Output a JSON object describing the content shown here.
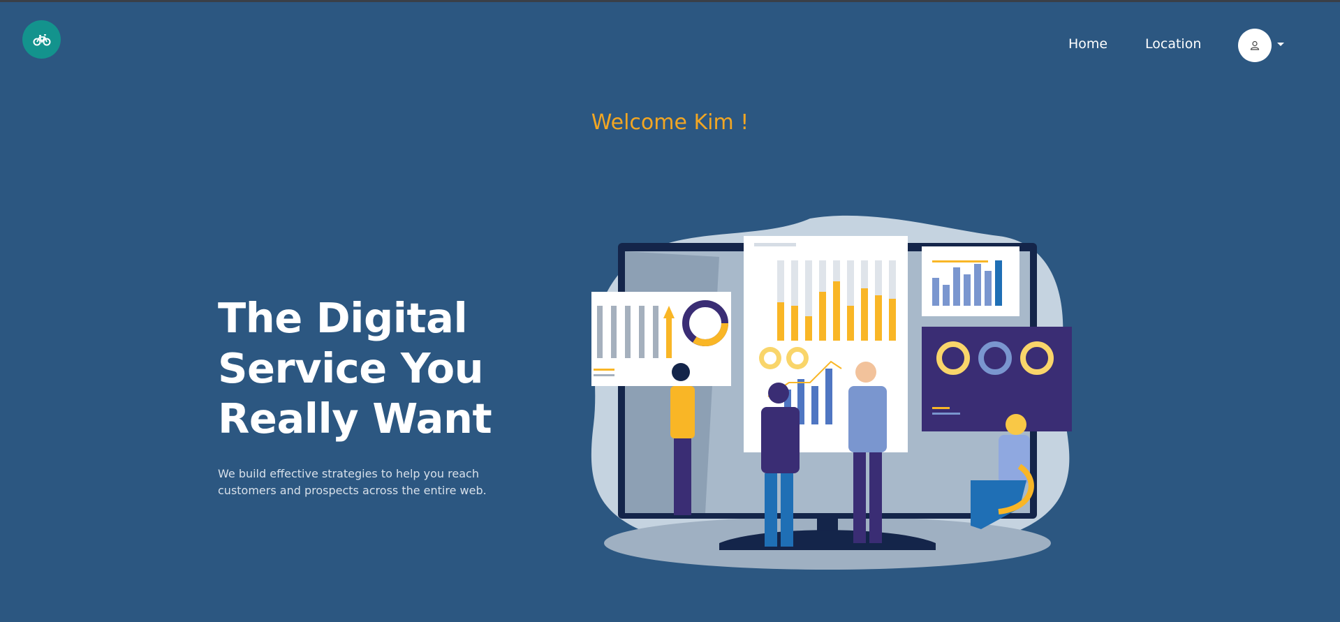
{
  "header": {
    "logo_icon": "bicycle-icon",
    "nav": [
      {
        "label": "Home"
      },
      {
        "label": "Location"
      }
    ],
    "user_icon": "user-icon",
    "dropdown_icon": "caret-down-icon"
  },
  "welcome": "Welcome Kim !",
  "hero": {
    "title_lines": [
      "The Digital",
      "Service You",
      "Really Want"
    ],
    "subtitle_lines": [
      "We build effective strategies to help you reach",
      "customers and prospects across the entire web."
    ]
  },
  "colors": {
    "background": "#2c5781",
    "logo": "#13938d",
    "welcome": "#f2a623",
    "accent_yellow": "#f9b626",
    "accent_blue": "#1f6fb5",
    "accent_purple": "#3a2d74"
  }
}
